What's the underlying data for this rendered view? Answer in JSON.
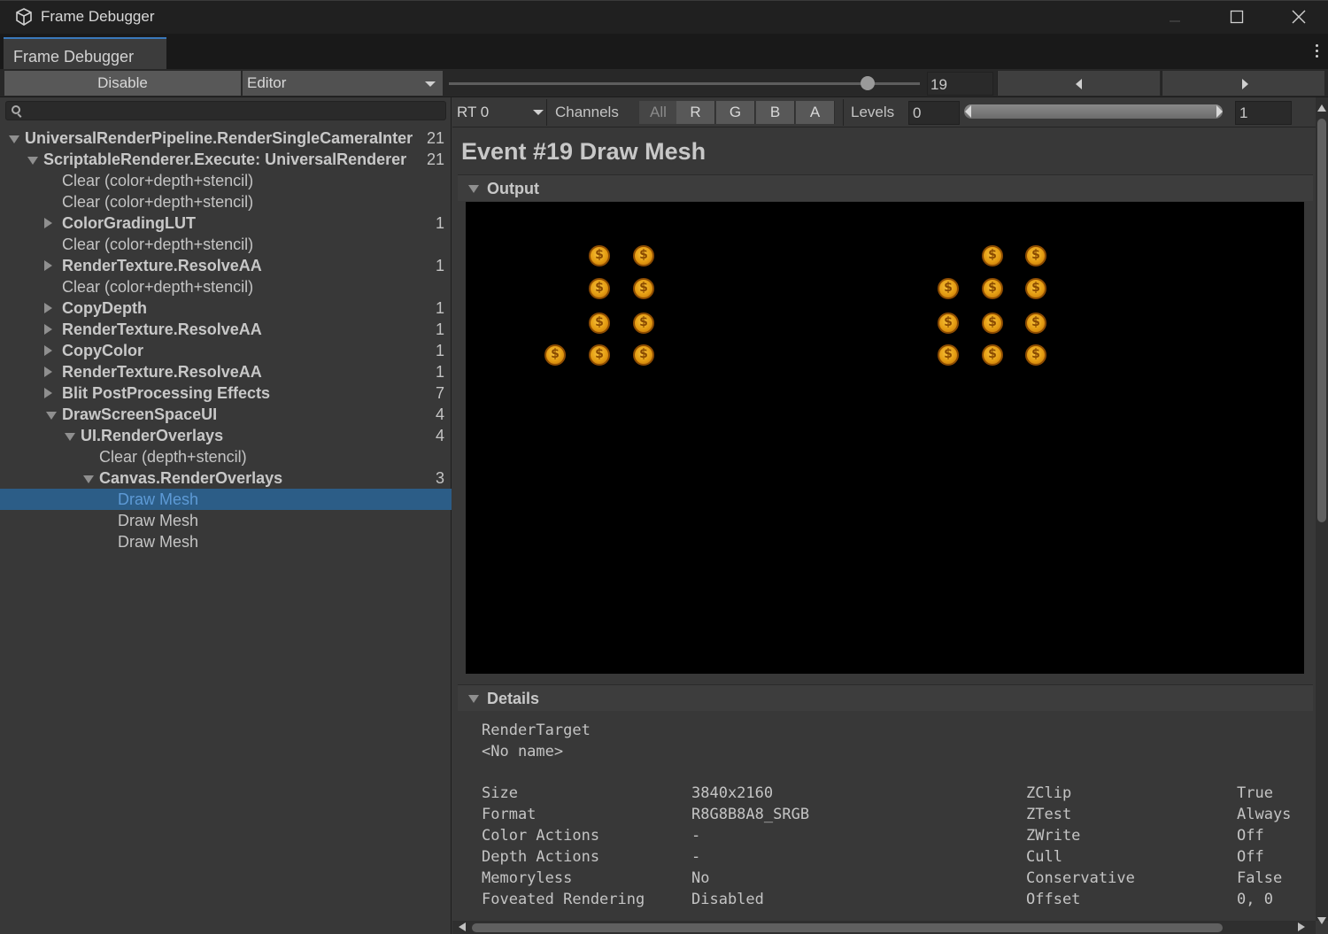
{
  "window": {
    "title": "Frame Debugger",
    "icon": "unity-cube-icon"
  },
  "tab": {
    "label": "Frame Debugger"
  },
  "toolbar": {
    "disable_label": "Disable",
    "target_dropdown": "Editor",
    "event_index": "19",
    "event_slider_fraction": 0.94
  },
  "search": {
    "placeholder": ""
  },
  "tree": [
    {
      "label": "UniversalRenderPipeline.RenderSingleCameraInter",
      "count": "21",
      "depth": 0,
      "expander": "down",
      "bold": true
    },
    {
      "label": "ScriptableRenderer.Execute: UniversalRenderer",
      "count": "21",
      "depth": 1,
      "expander": "down",
      "bold": true
    },
    {
      "label": "Clear (color+depth+stencil)",
      "count": "",
      "depth": 2,
      "expander": "",
      "bold": false
    },
    {
      "label": "Clear (color+depth+stencil)",
      "count": "",
      "depth": 2,
      "expander": "",
      "bold": false
    },
    {
      "label": "ColorGradingLUT",
      "count": "1",
      "depth": 2,
      "expander": "right",
      "bold": true
    },
    {
      "label": "Clear (color+depth+stencil)",
      "count": "",
      "depth": 2,
      "expander": "",
      "bold": false
    },
    {
      "label": "RenderTexture.ResolveAA",
      "count": "1",
      "depth": 2,
      "expander": "right",
      "bold": true
    },
    {
      "label": "Clear (color+depth+stencil)",
      "count": "",
      "depth": 2,
      "expander": "",
      "bold": false
    },
    {
      "label": "CopyDepth",
      "count": "1",
      "depth": 2,
      "expander": "right",
      "bold": true
    },
    {
      "label": "RenderTexture.ResolveAA",
      "count": "1",
      "depth": 2,
      "expander": "right",
      "bold": true
    },
    {
      "label": "CopyColor",
      "count": "1",
      "depth": 2,
      "expander": "right",
      "bold": true
    },
    {
      "label": "RenderTexture.ResolveAA",
      "count": "1",
      "depth": 2,
      "expander": "right",
      "bold": true
    },
    {
      "label": "Blit PostProcessing Effects",
      "count": "7",
      "depth": 2,
      "expander": "right",
      "bold": true
    },
    {
      "label": "DrawScreenSpaceUI",
      "count": "4",
      "depth": 2,
      "expander": "down",
      "bold": true
    },
    {
      "label": "UI.RenderOverlays",
      "count": "4",
      "depth": 3,
      "expander": "down",
      "bold": true
    },
    {
      "label": "Clear (depth+stencil)",
      "count": "",
      "depth": 4,
      "expander": "",
      "bold": false
    },
    {
      "label": "Canvas.RenderOverlays",
      "count": "3",
      "depth": 4,
      "expander": "down",
      "bold": true
    },
    {
      "label": "Draw Mesh",
      "count": "",
      "depth": 5,
      "expander": "",
      "bold": false,
      "selected": true
    },
    {
      "label": "Draw Mesh",
      "count": "",
      "depth": 5,
      "expander": "",
      "bold": false
    },
    {
      "label": "Draw Mesh",
      "count": "",
      "depth": 5,
      "expander": "",
      "bold": false
    }
  ],
  "preview_bar": {
    "render_target": "RT 0",
    "channels_label": "Channels",
    "channels": [
      "All",
      "R",
      "G",
      "B",
      "A"
    ],
    "levels_label": "Levels",
    "levels_min": "0",
    "levels_max": "1"
  },
  "event": {
    "title": "Event #19 Draw Mesh"
  },
  "output": {
    "section_label": "Output",
    "coin_icon": "coin-icon"
  },
  "details": {
    "section_label": "Details",
    "render_target_label": "RenderTarget",
    "render_target_name": "<No name>",
    "left_props": [
      {
        "key": "Size",
        "value": "3840x2160"
      },
      {
        "key": "Format",
        "value": "R8G8B8A8_SRGB"
      },
      {
        "key": "Color Actions",
        "value": "-"
      },
      {
        "key": "Depth Actions",
        "value": "-"
      },
      {
        "key": "Memoryless",
        "value": "No"
      },
      {
        "key": "Foveated Rendering",
        "value": "Disabled"
      }
    ],
    "right_props": [
      {
        "key": "ZClip",
        "value": "True"
      },
      {
        "key": "ZTest",
        "value": "Always"
      },
      {
        "key": "ZWrite",
        "value": "Off"
      },
      {
        "key": "Cull",
        "value": "Off"
      },
      {
        "key": "Conservative",
        "value": "False"
      },
      {
        "key": "Offset",
        "value": "0, 0"
      }
    ]
  }
}
